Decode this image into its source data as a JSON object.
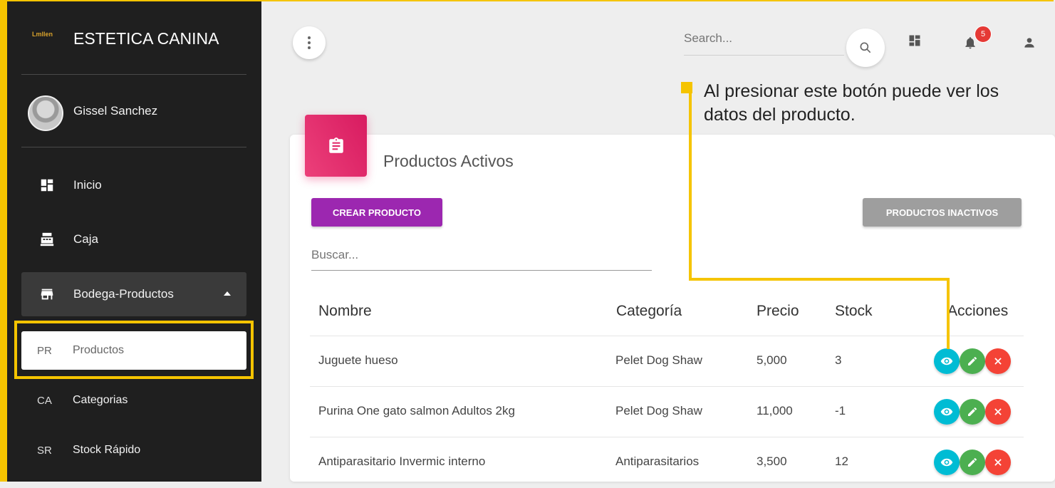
{
  "sidebar": {
    "logo_text": "Lmllen",
    "brand": "ESTETICA CANINA",
    "user_name": "Gissel Sanchez",
    "items": [
      {
        "label": "Inicio",
        "icon": "dashboard-icon"
      },
      {
        "label": "Caja",
        "icon": "cash-register-icon"
      },
      {
        "label": "Bodega-Productos",
        "icon": "store-icon"
      }
    ],
    "subitems": [
      {
        "abbr": "PR",
        "label": "Productos"
      },
      {
        "abbr": "CA",
        "label": "Categorias"
      },
      {
        "abbr": "SR",
        "label": "Stock Rápido"
      }
    ]
  },
  "topbar": {
    "search_placeholder": "Search...",
    "notification_count": "5"
  },
  "callout": {
    "text": "Al presionar este botón puede ver los datos del producto."
  },
  "card": {
    "title": "Productos Activos",
    "create_button": "CREAR PRODUCTO",
    "inactive_button": "PRODUCTOS INACTIVOS",
    "filter_placeholder": "Buscar..."
  },
  "table": {
    "headers": [
      "Nombre",
      "Categoría",
      "Precio",
      "Stock",
      "Acciones"
    ],
    "rows": [
      {
        "nombre": "Juguete hueso",
        "categoria": "Pelet Dog Shaw",
        "precio": "5,000",
        "stock": "3"
      },
      {
        "nombre": "Purina One gato salmon Adultos 2kg",
        "categoria": "Pelet Dog Shaw",
        "precio": "11,000",
        "stock": "-1"
      },
      {
        "nombre": "Antiparasitario Invermic interno",
        "categoria": "Antiparasitarios",
        "precio": "3,500",
        "stock": "12"
      }
    ]
  },
  "colors": {
    "accent_highlight": "#f5c400",
    "create_button": "#9c27b0",
    "card_icon": "#e91e63",
    "view_action": "#00bcd4",
    "edit_action": "#4caf50",
    "delete_action": "#f44336"
  }
}
